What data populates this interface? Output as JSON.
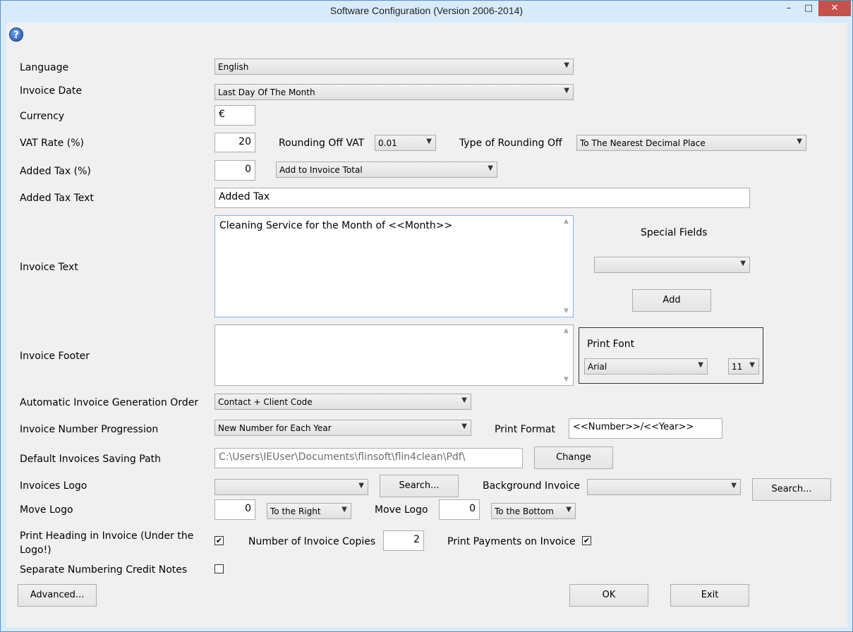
{
  "window": {
    "title": "Software Configuration (Version 2006-2014)",
    "minimize_glyph": "–",
    "maximize_glyph": "□",
    "close_glyph": "✕"
  },
  "help_icon": "?",
  "language": {
    "label": "Language",
    "value": "English"
  },
  "invoice_date": {
    "label": "Invoice Date",
    "value": "Last Day Of The Month"
  },
  "currency": {
    "label": "Currency",
    "value": "€"
  },
  "vat": {
    "label": "VAT Rate (%)",
    "value": "20",
    "rounding_label": "Rounding Off VAT",
    "rounding_value": "0.01",
    "type_label": "Type of Rounding Off",
    "type_value": "To The Nearest Decimal Place"
  },
  "added_tax": {
    "label": "Added Tax (%)",
    "value": "0",
    "mode": "Add to Invoice Total"
  },
  "added_tax_text": {
    "label": "Added Tax Text",
    "value": "Added Tax"
  },
  "invoice_text": {
    "label": "Invoice Text",
    "value": "Cleaning Service for the Month of <<Month>>"
  },
  "special_fields": {
    "label": "Special Fields",
    "value": "",
    "add_label": "Add"
  },
  "invoice_footer": {
    "label": "Invoice Footer",
    "value": ""
  },
  "print_font": {
    "label": "Print Font",
    "font": "Arial",
    "size": "11"
  },
  "auto_order": {
    "label": "Automatic Invoice Generation Order",
    "value": "Contact + Client Code"
  },
  "number_progression": {
    "label": "Invoice Number Progression",
    "value": "New Number for Each Year",
    "format_label": "Print Format",
    "format_value": "<<Number>>/<<Year>>"
  },
  "saving_path": {
    "label": "Default Invoices Saving Path",
    "value": "C:\\Users\\IEUser\\Documents\\flinsoft\\flin4clean\\Pdf\\",
    "change_label": "Change"
  },
  "logo": {
    "label": "Invoices Logo",
    "value": "",
    "search_label": "Search...",
    "background_label": "Background Invoice",
    "background_value": "",
    "background_search_label": "Search..."
  },
  "move_logo": {
    "label": "Move Logo",
    "h_value": "0",
    "h_dir": "To the Right",
    "label2": "Move Logo",
    "v_value": "0",
    "v_dir": "To the Bottom"
  },
  "print_heading": {
    "label": "Print Heading in Invoice (Under the Logo!)",
    "checked": "✔"
  },
  "copies": {
    "label": "Number of Invoice Copies",
    "value": "2"
  },
  "print_payments": {
    "label": "Print Payments on Invoice",
    "checked": "✔"
  },
  "separate_numbering": {
    "label": "Separate Numbering Credit Notes",
    "checked": ""
  },
  "buttons": {
    "advanced": "Advanced...",
    "ok": "OK",
    "exit": "Exit"
  },
  "dropdown_arrow": "▼"
}
